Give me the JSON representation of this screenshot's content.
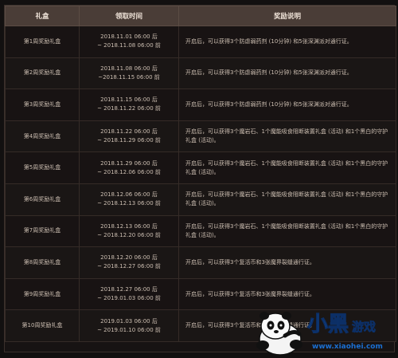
{
  "table": {
    "headers": [
      "礼盒",
      "领取时间",
      "奖励说明"
    ],
    "rows": [
      {
        "name": "第1周奖励礼盒",
        "time_start": "2018.11.01 06:00 后",
        "time_end": "~ 2018.11.08 06:00 前",
        "desc": "开启后，可以获得3个防虐弱药剂 (10分钟) 和5张深渊派对通行证。"
      },
      {
        "name": "第2周奖励礼盒",
        "time_start": "2018.11.08 06:00 后",
        "time_end": "~2018.11.15 06:00 前",
        "desc": "开启后，可以获得3个防虐弱药剂 (10分钟) 和5张深渊派对通行证。"
      },
      {
        "name": "第3周奖励礼盒",
        "time_start": "2018.11.15 06:00 后",
        "time_end": "~ 2018.11.22 06:00 前",
        "desc": "开启后，可以获得3个防虐弱药剂 (10分钟) 和5张深渊派对通行证。"
      },
      {
        "name": "第4周奖励礼盒",
        "time_start": "2018.11.22 06:00 后",
        "time_end": "~ 2018.11.29 06:00 前",
        "desc": "开启后，可以获得3个魔岩石、1个魔能吸食阻断装置礼盒 (活动) 和1个黑白的守护礼盒 (活动)。"
      },
      {
        "name": "第5周奖励礼盒",
        "time_start": "2018.11.29 06:00 后",
        "time_end": "~ 2018.12.06 06:00 前",
        "desc": "开启后，可以获得3个魔岩石、1个魔能吸食阻断装置礼盒 (活动) 和1个黑白的守护礼盒 (活动)。"
      },
      {
        "name": "第6周奖励礼盒",
        "time_start": "2018.12.06 06:00 后",
        "time_end": "~ 2018.12.13 06:00 前",
        "desc": "开启后，可以获得3个魔岩石、1个魔能吸食阻断装置礼盒 (活动) 和1个黑白的守护礼盒 (活动)。"
      },
      {
        "name": "第7周奖励礼盒",
        "time_start": "2018.12.13 06:00 后",
        "time_end": "~ 2018.12.20 06:00 前",
        "desc": "开启后，可以获得3个魔岩石、1个魔能吸食阻断装置礼盒 (活动) 和1个黑白的守护礼盒 (活动)。"
      },
      {
        "name": "第8周奖励礼盒",
        "time_start": "2018.12.20 06:00 后",
        "time_end": "~ 2018.12.27 06:00 前",
        "desc": "开启后，可以获得3个复活币和3张魔界裂缝通行证。"
      },
      {
        "name": "第9周奖励礼盒",
        "time_start": "2018.12.27 06:00 后",
        "time_end": "~ 2019.01.03 06:00 前",
        "desc": "开启后，可以获得3个复活币和3张魔界裂缝通行证。"
      },
      {
        "name": "第10周奖励礼盒",
        "time_start": "2019.01.03 06:00 后",
        "time_end": "~ 2019.01.10 06:00 前",
        "desc": "开启后，可以获得3个复活币和3张魔界裂缝通行证。"
      }
    ]
  },
  "watermark": {
    "brand": "小黑游戏",
    "url": "www.xiaohei.com",
    "icon": "panda-mascot-icon",
    "colors": {
      "blue": "#1b6fd1",
      "dark": "#0c2f66"
    }
  }
}
